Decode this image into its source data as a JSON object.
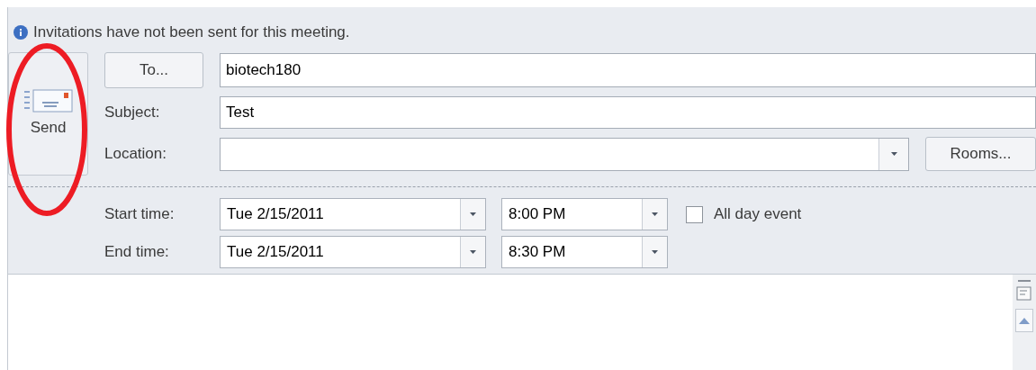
{
  "info_bar": {
    "text": "Invitations have not been sent for this meeting."
  },
  "send_button": {
    "label": "Send"
  },
  "to": {
    "button": "To...",
    "value": "biotech180"
  },
  "subject": {
    "label": "Subject:",
    "value": "Test"
  },
  "location": {
    "label": "Location:",
    "button": "Rooms..."
  },
  "start": {
    "label": "Start time:",
    "date": "Tue 2/15/2011",
    "time": "8:00 PM"
  },
  "all_day": {
    "label": "All day event",
    "checked": false
  },
  "end": {
    "label": "End time:",
    "date": "Tue 2/15/2011",
    "time": "8:30 PM"
  },
  "annotation": {
    "kind": "ellipse",
    "color": "#ed1c24"
  }
}
